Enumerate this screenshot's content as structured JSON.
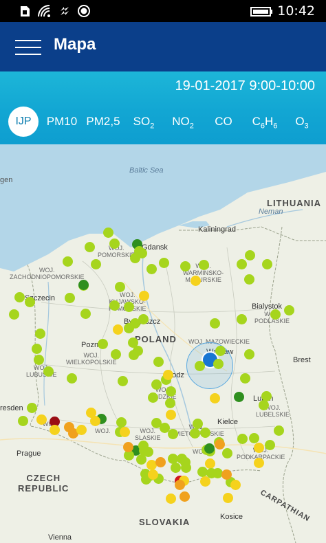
{
  "status_bar": {
    "time": "10:42",
    "icons": [
      "sim-icon",
      "wifi-icon",
      "data-icon",
      "location-icon",
      "battery-icon"
    ]
  },
  "header": {
    "menu_icon": "hamburger-menu-icon",
    "title": "Mapa"
  },
  "band": {
    "date_range": "19-01-2017 9:00-10:00",
    "tabs": [
      {
        "id": "ijp",
        "base": "IJP",
        "sub": "",
        "active": true
      },
      {
        "id": "pm10",
        "base": "PM10",
        "sub": "",
        "active": false
      },
      {
        "id": "pm25",
        "base": "PM2,5",
        "sub": "",
        "active": false
      },
      {
        "id": "so2",
        "base": "SO",
        "sub": "2",
        "active": false
      },
      {
        "id": "no2",
        "base": "NO",
        "sub": "2",
        "active": false
      },
      {
        "id": "co",
        "base": "CO",
        "sub": "",
        "active": false
      },
      {
        "id": "c6h6",
        "base": "C",
        "sub": "6",
        "base2": "H",
        "sub2": "6",
        "active": false
      },
      {
        "id": "o3",
        "base": "O",
        "sub": "3",
        "active": false
      }
    ]
  },
  "map": {
    "labels": {
      "sea": "Baltic\nSea",
      "lithuania": "LITHUANIA",
      "poland": "POLAND",
      "czech": "CZECH\nREPUBLIC",
      "slovakia": "SLOVAKIA",
      "carpathian": "CARPATHIAN",
      "neman": "Neman",
      "gen": "gen",
      "kaliningrad": "Kaliningrad",
      "gdansk": "Gdansk",
      "szczecin": "Szczecin",
      "bydgoszcz": "Bydgoszcz",
      "poznan": "Poznan",
      "warsaw": "Warsaw",
      "bialystok": "Bialystok",
      "brest": "Brest",
      "lodz": "Lodz",
      "lublin": "Lublin",
      "kielce": "Kielce",
      "prague": "Prague",
      "kosice": "Kosice",
      "vienna": "Vienna",
      "dresden": "resden",
      "woj_pomorskie": "WOJ.\nPOMORSKIE",
      "woj_zachodniopomorskie": "WOJ.\nZACHODNIOPOMORSKIE",
      "woj_warminsko": "WOJ.\nWARMINSKO-\nMAZURSKIE",
      "woj_kujawsko": "WOJ.\nKUJAWSKO-\nPOMORSKIE",
      "woj_podlaskie": "WOJ.\nPODLASKIE",
      "woj_mazowieckie": "WOJ. MAZOWIECKIE",
      "woj_wielkopolskie": "WOJ.\nWIELKOPOLSKIE",
      "woj_lubuskie": "WOJ.\nLUBUSKIE",
      "woj_lodzkie": "WOJ.\nLODZKIE",
      "woj_lubelskie": "WOJ.\nLUBELSKIE",
      "woj_slaskie": "WOJ.\nSLASKIE",
      "woj_swietokrzyskie": "WOJ.\nSWIETOKRZYSKIE",
      "woj_podkarpackie": "WOJ.\nPODKARPACKIE",
      "woj_opolskie": "WOJ.",
      "woj_dolnoslaskie": "WOJ.",
      "woj_malopolskie": "WOJ."
    },
    "colors": {
      "very_good": "#5fb51c",
      "good": "#a6d51d",
      "moderate": "#f5d21d",
      "sufficient": "#f0a11e",
      "bad": "#e5561b",
      "very_bad": "#d0161b",
      "extreme": "#9a0e14",
      "dark_green": "#2f8f1f"
    },
    "stations": [
      {
        "c": "good"
      },
      {
        "c": "good"
      },
      {
        "c": "good"
      },
      {
        "c": "dark_green"
      },
      {
        "c": "good"
      },
      {
        "c": "good"
      },
      {
        "c": "good"
      },
      {
        "c": "good"
      },
      {
        "c": "good"
      },
      {
        "c": "good"
      },
      {
        "c": "dark_green"
      },
      {
        "c": "good"
      },
      {
        "c": "good"
      },
      {
        "c": "good"
      },
      {
        "c": "good"
      },
      {
        "c": "good"
      },
      {
        "c": "moderate"
      },
      {
        "c": "good"
      },
      {
        "c": "good"
      },
      {
        "c": "good"
      },
      {
        "c": "good"
      },
      {
        "c": "good"
      },
      {
        "c": "good"
      },
      {
        "c": "good"
      },
      {
        "c": "good"
      },
      {
        "c": "moderate"
      },
      {
        "c": "good"
      },
      {
        "c": "good"
      },
      {
        "c": "good"
      },
      {
        "c": "good"
      },
      {
        "c": "good"
      },
      {
        "c": "moderate"
      },
      {
        "c": "good"
      },
      {
        "c": "good"
      },
      {
        "c": "good"
      },
      {
        "c": "good"
      },
      {
        "c": "good"
      },
      {
        "c": "good"
      },
      {
        "c": "good"
      },
      {
        "c": "good"
      },
      {
        "c": "good"
      },
      {
        "c": "good"
      },
      {
        "c": "good"
      },
      {
        "c": "good"
      },
      {
        "c": "good"
      },
      {
        "c": "good"
      },
      {
        "c": "good"
      },
      {
        "c": "moderate"
      },
      {
        "c": "good"
      },
      {
        "c": "good"
      },
      {
        "c": "good"
      },
      {
        "c": "good"
      },
      {
        "c": "good"
      },
      {
        "c": "good"
      },
      {
        "c": "good"
      },
      {
        "c": "good"
      },
      {
        "c": "moderate"
      },
      {
        "c": "good"
      },
      {
        "c": "dark_green"
      },
      {
        "c": "good"
      },
      {
        "c": "good"
      },
      {
        "c": "good"
      },
      {
        "c": "good"
      },
      {
        "c": "moderate"
      },
      {
        "c": "good"
      },
      {
        "c": "good"
      },
      {
        "c": "dark_green"
      },
      {
        "c": "extreme"
      },
      {
        "c": "moderate"
      },
      {
        "c": "moderate"
      },
      {
        "c": "sufficient"
      },
      {
        "c": "sufficient"
      },
      {
        "c": "moderate"
      },
      {
        "c": "moderate"
      },
      {
        "c": "moderate"
      },
      {
        "c": "good"
      },
      {
        "c": "dark_green"
      },
      {
        "c": "moderate"
      },
      {
        "c": "good"
      },
      {
        "c": "good"
      },
      {
        "c": "good"
      },
      {
        "c": "good"
      },
      {
        "c": "good"
      },
      {
        "c": "good"
      },
      {
        "c": "good"
      },
      {
        "c": "good"
      },
      {
        "c": "good"
      },
      {
        "c": "good"
      },
      {
        "c": "good"
      },
      {
        "c": "good"
      },
      {
        "c": "good"
      },
      {
        "c": "good"
      },
      {
        "c": "good"
      },
      {
        "c": "good"
      },
      {
        "c": "moderate"
      },
      {
        "c": "moderate"
      },
      {
        "c": "good"
      },
      {
        "c": "dark_green"
      },
      {
        "c": "sufficient"
      },
      {
        "c": "good"
      },
      {
        "c": "good"
      },
      {
        "c": "sufficient"
      },
      {
        "c": "good"
      },
      {
        "c": "good"
      },
      {
        "c": "moderate"
      },
      {
        "c": "sufficient"
      },
      {
        "c": "good"
      },
      {
        "c": "good"
      },
      {
        "c": "good"
      },
      {
        "c": "moderate"
      },
      {
        "c": "good"
      },
      {
        "c": "good"
      },
      {
        "c": "good"
      },
      {
        "c": "good"
      },
      {
        "c": "good"
      },
      {
        "c": "good"
      },
      {
        "c": "good"
      },
      {
        "c": "very_bad"
      },
      {
        "c": "moderate"
      },
      {
        "c": "good"
      },
      {
        "c": "moderate"
      },
      {
        "c": "sufficient"
      },
      {
        "c": "sufficient"
      },
      {
        "c": "moderate"
      },
      {
        "c": "moderate"
      },
      {
        "c": "sufficient"
      },
      {
        "c": "moderate"
      },
      {
        "c": "good"
      },
      {
        "c": "good"
      },
      {
        "c": "moderate"
      }
    ]
  }
}
